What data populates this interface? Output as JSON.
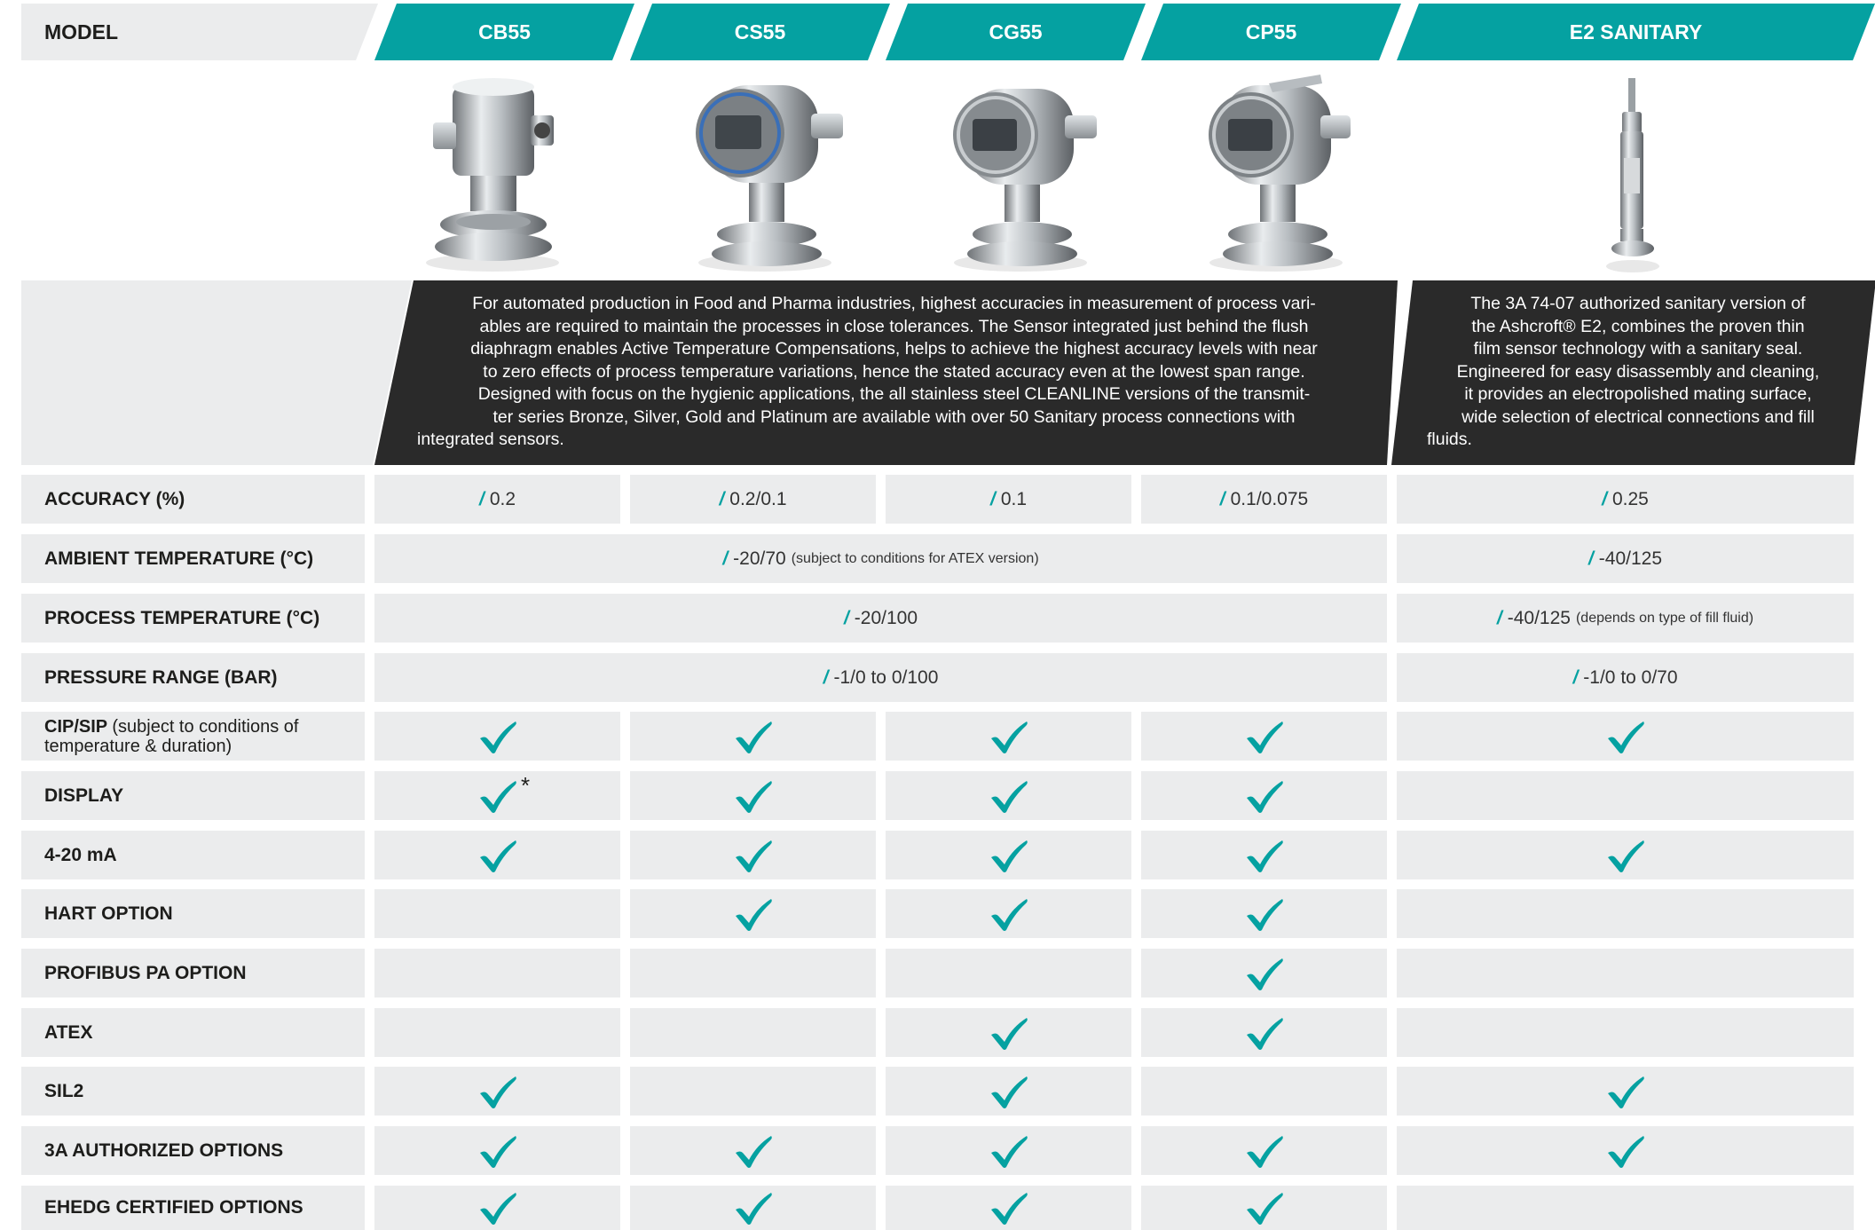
{
  "header": {
    "model_label": "MODEL",
    "models": [
      "CB55",
      "CS55",
      "CG55",
      "CP55",
      "E2 SANITARY"
    ],
    "accent_color": "#05a1a1"
  },
  "description": {
    "main_lines": [
      "For automated production in Food and Pharma industries, highest accuracies in measurement of process vari-",
      "ables are required to maintain the processes in close tolerances. The Sensor integrated just behind the flush",
      "diaphragm enables Active Temperature Compensations, helps to achieve the highest accuracy levels with near",
      "to zero effects of process temperature variations, hence the stated accuracy even at the lowest span range.",
      "Designed with focus on the hygienic applications, the all stainless steel CLEANLINE versions of the transmit-",
      "ter series Bronze, Silver, Gold and Platinum are available with over 50 Sanitary process connections with",
      "integrated sensors."
    ],
    "e2_lines": [
      "The 3A 74-07 authorized sanitary version of",
      "the Ashcroft® E2, combines the proven thin",
      "film sensor technology with a sanitary seal.",
      "Engineered for easy disassembly and cleaning,",
      "it provides an electropolished mating surface,",
      "wide selection of electrical connections and fill",
      "fluids."
    ]
  },
  "rows": {
    "accuracy": {
      "label": "ACCURACY (%)",
      "values": [
        "0.2",
        "0.2/0.1",
        "0.1",
        "0.1/0.075",
        "0.25"
      ]
    },
    "ambient": {
      "label": "AMBIENT TEMPERATURE (°C)",
      "value_main": "-20/70",
      "value_main_note": "(subject to conditions for ATEX version)",
      "value_e2": "-40/125"
    },
    "process": {
      "label": "PROCESS TEMPERATURE (°C)",
      "value_main": "-20/100",
      "value_e2": "-40/125",
      "value_e2_note": "(depends on type of fill fluid)"
    },
    "pressure": {
      "label": "PRESSURE RANGE (BAR)",
      "value_main": "-1/0 to 0/100",
      "value_e2": "-1/0 to 0/70"
    },
    "cip": {
      "label_bold": "CIP/SIP",
      "label_rest": "(subject to conditions of",
      "label_line2": "temperature & duration)",
      "checks": [
        true,
        true,
        true,
        true,
        true
      ]
    },
    "display": {
      "label": "DISPLAY",
      "checks": [
        true,
        true,
        true,
        true,
        false
      ],
      "footnote_mark": "*"
    },
    "ma": {
      "label": "4-20 mA",
      "checks": [
        true,
        true,
        true,
        true,
        true
      ]
    },
    "hart": {
      "label": "HART OPTION",
      "checks": [
        false,
        true,
        true,
        true,
        false
      ]
    },
    "profibus": {
      "label": "PROFIBUS PA OPTION",
      "checks": [
        false,
        false,
        false,
        true,
        false
      ]
    },
    "atex": {
      "label": "ATEX",
      "checks": [
        false,
        false,
        true,
        true,
        false
      ]
    },
    "sil2": {
      "label": "SIL2",
      "checks": [
        true,
        false,
        true,
        false,
        true
      ]
    },
    "threea": {
      "label": "3A AUTHORIZED OPTIONS",
      "checks": [
        true,
        true,
        true,
        true,
        true
      ]
    },
    "ehedg": {
      "label": "EHEDG CERTIFIED OPTIONS",
      "checks": [
        true,
        true,
        true,
        true,
        false
      ]
    }
  }
}
